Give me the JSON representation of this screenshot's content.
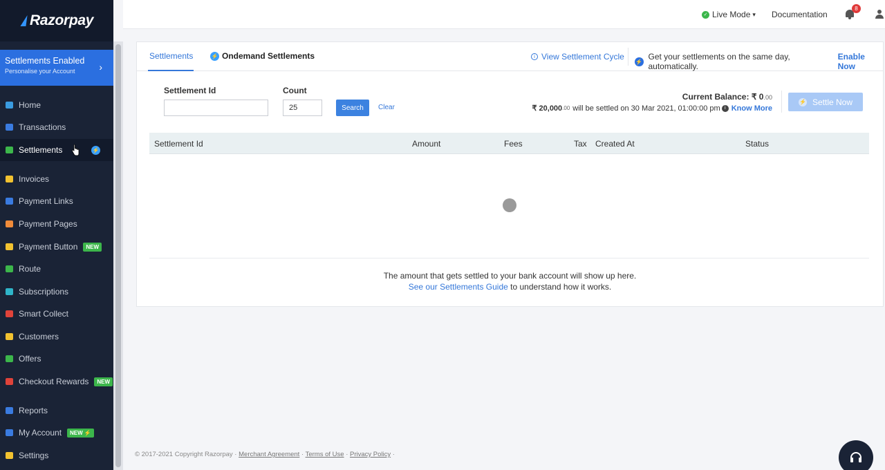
{
  "brand": {
    "name": "Razorpay"
  },
  "banner": {
    "title": "Settlements Enabled",
    "subtitle": "Personalise your Account",
    "arrow": "›"
  },
  "sidebar": {
    "items": [
      {
        "label": "Home",
        "icon": "home-icon",
        "color": "#3a9be0"
      },
      {
        "label": "Transactions",
        "icon": "transactions-icon",
        "color": "#3a7be0"
      },
      {
        "label": "Settlements",
        "icon": "settlements-icon",
        "color": "#3cb64b",
        "active": true,
        "bolt": "⚡"
      },
      {
        "label": "Invoices",
        "icon": "invoices-icon",
        "color": "#f2c230"
      },
      {
        "label": "Payment Links",
        "icon": "payment-links-icon",
        "color": "#3a7be0"
      },
      {
        "label": "Payment Pages",
        "icon": "payment-pages-icon",
        "color": "#f08b3a"
      },
      {
        "label": "Payment Button",
        "icon": "payment-button-icon",
        "color": "#f2c230",
        "badge": "NEW"
      },
      {
        "label": "Route",
        "icon": "route-icon",
        "color": "#3cb64b"
      },
      {
        "label": "Subscriptions",
        "icon": "subscriptions-icon",
        "color": "#2fb5c9"
      },
      {
        "label": "Smart Collect",
        "icon": "smart-collect-icon",
        "color": "#e0433a"
      },
      {
        "label": "Customers",
        "icon": "customers-icon",
        "color": "#f2c230"
      },
      {
        "label": "Offers",
        "icon": "offers-icon",
        "color": "#3cb64b"
      },
      {
        "label": "Checkout Rewards",
        "icon": "checkout-rewards-icon",
        "color": "#e0433a",
        "badge": "NEW"
      },
      {
        "label": "Reports",
        "icon": "reports-icon",
        "color": "#3a7be0"
      },
      {
        "label": "My Account",
        "icon": "my-account-icon",
        "color": "#3a7be0",
        "badge": "NEW ⚡"
      },
      {
        "label": "Settings",
        "icon": "settings-icon",
        "color": "#f2c230"
      }
    ]
  },
  "header": {
    "mode": "Live Mode",
    "mode_caret": "▾",
    "mode_check": "✓",
    "docs": "Documentation",
    "notifications": "8"
  },
  "tabs": {
    "settlements": "Settlements",
    "ondemand": "Ondemand Settlements",
    "bolt": "⚡"
  },
  "cycle": {
    "label": "View Settlement Cycle",
    "info": "i"
  },
  "promo": {
    "text": "Get your settlements on the same day, automatically.",
    "cta": "Enable Now"
  },
  "filters": {
    "settlement_id_label": "Settlement Id",
    "settlement_id_value": "",
    "count_label": "Count",
    "count_value": "25",
    "search": "Search",
    "clear": "Clear"
  },
  "balance": {
    "label": "Current Balance:",
    "amount": "₹ 0",
    "decimals": ".00",
    "pending_amount": "₹ 20,000",
    "pending_decimals": ".00",
    "pending_text": "will be settled on 30 Mar 2021, 01:00:00 pm",
    "info": "i",
    "know_more": "Know More",
    "settle_now": "Settle Now"
  },
  "table": {
    "columns": [
      "Settlement Id",
      "Amount",
      "Fees",
      "Tax",
      "Created At",
      "Status"
    ],
    "rows": []
  },
  "empty_state": {
    "line1": "The amount that gets settled to your bank account will show up here.",
    "link": "See our Settlements Guide",
    "line2_rest": " to understand how it works."
  },
  "footer": {
    "copyright": "© 2017-2021 Copyright Razorpay",
    "sep": " · ",
    "links": [
      "Merchant Agreement",
      "Terms of Use",
      "Privacy Policy"
    ]
  }
}
